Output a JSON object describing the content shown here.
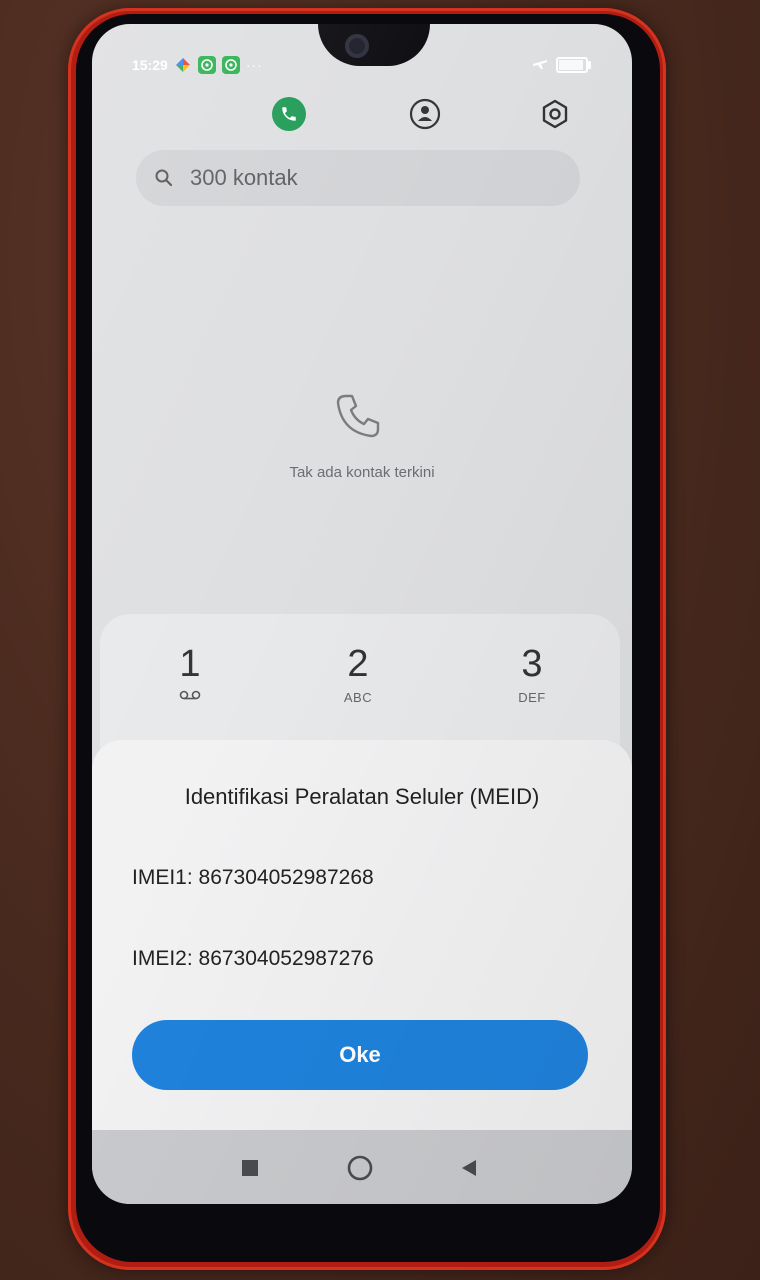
{
  "status_bar": {
    "time": "15:29",
    "more_dots": "···",
    "battery_level": 0.85,
    "notification_icons": [
      "assistant-icon",
      "whatsapp-icon",
      "whatsapp-icon"
    ]
  },
  "tabs": [
    {
      "name": "phone-tab",
      "icon": "phone-icon",
      "active": true
    },
    {
      "name": "contacts-tab",
      "icon": "contact-icon",
      "active": false
    },
    {
      "name": "settings-tab",
      "icon": "gear-icon",
      "active": false
    }
  ],
  "search": {
    "placeholder": "300 kontak"
  },
  "recents": {
    "empty_text": "Tak ada kontak terkini"
  },
  "keypad": {
    "keys": [
      {
        "digit": "1",
        "letters": ""
      },
      {
        "digit": "2",
        "letters": "ABC"
      },
      {
        "digit": "3",
        "letters": "DEF"
      }
    ]
  },
  "dialog": {
    "title": "Identifikasi Peralatan Seluler (MEID)",
    "imei1": "IMEI1: 867304052987268",
    "imei2": "IMEI2: 867304052987276",
    "ok_label": "Oke"
  },
  "colors": {
    "accent": "#1f82dc",
    "phone_tab": "#1e9a55",
    "phone_case": "#b11d12"
  }
}
